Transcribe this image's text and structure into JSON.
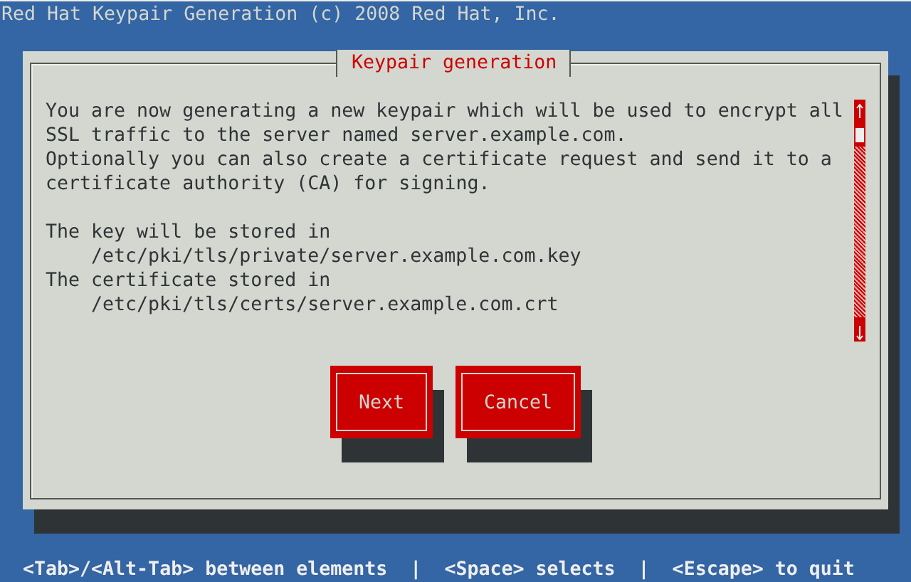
{
  "screen_title": "Red Hat Keypair Generation (c) 2008 Red Hat, Inc.",
  "dialog": {
    "title": "Keypair generation",
    "paragraphs": [
      [
        {
          "kind": "text",
          "text": "You are now generating a new keypair which will be used to encrypt all"
        },
        {
          "kind": "text",
          "text": "SSL traffic to the server named server.example.com."
        },
        {
          "kind": "text",
          "text": "Optionally you can also create a certificate request and send it to a"
        },
        {
          "kind": "text",
          "text": "certificate authority (CA) for signing."
        }
      ],
      [
        {
          "kind": "text",
          "text": "The key will be stored in"
        },
        {
          "kind": "path",
          "text": "/etc/pki/tls/private/server.example.com.key"
        },
        {
          "kind": "text",
          "text": "The certificate stored in"
        },
        {
          "kind": "path",
          "text": "/etc/pki/tls/certs/server.example.com.crt"
        }
      ]
    ],
    "buttons": [
      {
        "label": "Next"
      },
      {
        "label": "Cancel"
      }
    ]
  },
  "help_line": "<Tab>/<Alt-Tab> between elements  |  <Space> selects  |  <Escape> to quit"
}
